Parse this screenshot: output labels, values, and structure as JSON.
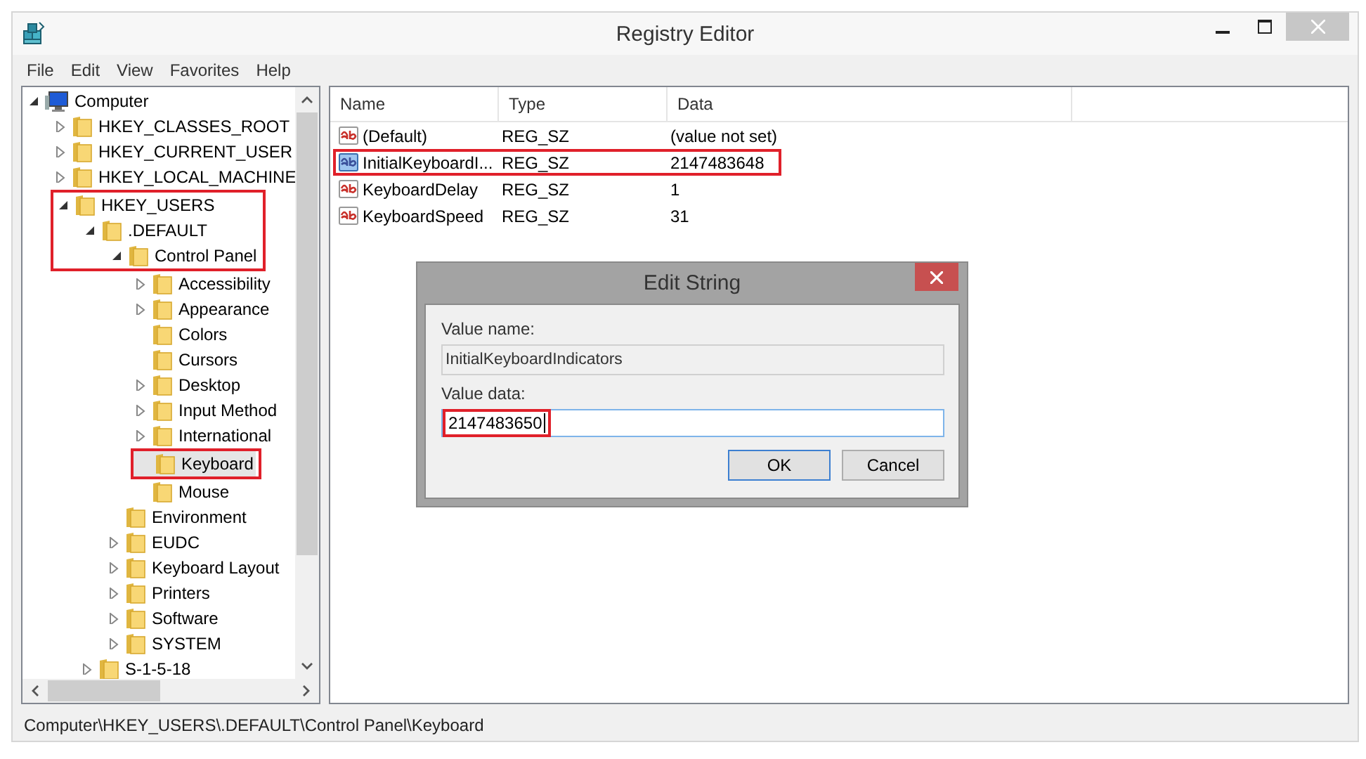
{
  "window": {
    "title": "Registry Editor"
  },
  "menu": [
    "File",
    "Edit",
    "View",
    "Favorites",
    "Help"
  ],
  "tree": [
    {
      "label": "Computer",
      "kind": "computer",
      "expanded": true,
      "selected": false,
      "highlighted": false,
      "children": [
        {
          "label": "HKEY_CLASSES_ROOT",
          "kind": "folder",
          "expanded": false,
          "selected": false,
          "highlighted": false
        },
        {
          "label": "HKEY_CURRENT_USER",
          "kind": "folder",
          "expanded": false,
          "selected": false,
          "highlighted": false
        },
        {
          "label": "HKEY_LOCAL_MACHINE",
          "kind": "folder",
          "expanded": false,
          "selected": false,
          "highlighted": false
        },
        {
          "label": "HKEY_USERS",
          "kind": "folder",
          "expanded": true,
          "selected": false,
          "highlighted": true,
          "children": [
            {
              "label": ".DEFAULT",
              "kind": "folder",
              "expanded": true,
              "selected": false,
              "highlighted": true,
              "children": [
                {
                  "label": "Control Panel",
                  "kind": "folder",
                  "expanded": true,
                  "selected": false,
                  "highlighted": true,
                  "children": [
                    {
                      "label": "Accessibility",
                      "kind": "folder",
                      "expanded": false,
                      "selected": false,
                      "highlighted": false
                    },
                    {
                      "label": "Appearance",
                      "kind": "folder",
                      "expanded": false,
                      "selected": false,
                      "highlighted": false
                    },
                    {
                      "label": "Colors",
                      "kind": "folder",
                      "selected": false,
                      "highlighted": false
                    },
                    {
                      "label": "Cursors",
                      "kind": "folder",
                      "selected": false,
                      "highlighted": false
                    },
                    {
                      "label": "Desktop",
                      "kind": "folder",
                      "expanded": false,
                      "selected": false,
                      "highlighted": false
                    },
                    {
                      "label": "Input Method",
                      "kind": "folder",
                      "expanded": false,
                      "selected": false,
                      "highlighted": false
                    },
                    {
                      "label": "International",
                      "kind": "folder",
                      "expanded": false,
                      "selected": false,
                      "highlighted": false
                    },
                    {
                      "label": "Keyboard",
                      "kind": "folder",
                      "selected": true,
                      "highlighted": true
                    },
                    {
                      "label": "Mouse",
                      "kind": "folder",
                      "selected": false,
                      "highlighted": false
                    }
                  ]
                },
                {
                  "label": "Environment",
                  "kind": "folder",
                  "selected": false,
                  "highlighted": false
                },
                {
                  "label": "EUDC",
                  "kind": "folder",
                  "expanded": false,
                  "selected": false,
                  "highlighted": false
                },
                {
                  "label": "Keyboard Layout",
                  "kind": "folder",
                  "expanded": false,
                  "selected": false,
                  "highlighted": false
                },
                {
                  "label": "Printers",
                  "kind": "folder",
                  "expanded": false,
                  "selected": false,
                  "highlighted": false
                },
                {
                  "label": "Software",
                  "kind": "folder",
                  "expanded": false,
                  "selected": false,
                  "highlighted": false
                },
                {
                  "label": "SYSTEM",
                  "kind": "folder",
                  "expanded": false,
                  "selected": false,
                  "highlighted": false
                }
              ]
            },
            {
              "label": "S-1-5-18",
              "kind": "folder",
              "expanded": false,
              "selected": false,
              "highlighted": false
            }
          ]
        }
      ]
    }
  ],
  "values": {
    "columns": [
      "Name",
      "Type",
      "Data"
    ],
    "rows": [
      {
        "name": "(Default)",
        "type": "REG_SZ",
        "data": "(value not set)",
        "selected": false,
        "highlighted": false
      },
      {
        "name": "InitialKeyboardI...",
        "type": "REG_SZ",
        "data": "2147483648",
        "selected": true,
        "highlighted": true
      },
      {
        "name": "KeyboardDelay",
        "type": "REG_SZ",
        "data": "1",
        "selected": false,
        "highlighted": false
      },
      {
        "name": "KeyboardSpeed",
        "type": "REG_SZ",
        "data": "31",
        "selected": false,
        "highlighted": false
      }
    ]
  },
  "dialog": {
    "title": "Edit String",
    "value_name_label": "Value name:",
    "value_name": "InitialKeyboardIndicators",
    "value_data_label": "Value data:",
    "value_data": "2147483650",
    "value_data_highlighted": true,
    "buttons": [
      {
        "label": "OK",
        "default": true
      },
      {
        "label": "Cancel",
        "default": false
      }
    ]
  },
  "status_bar": "Computer\\HKEY_USERS\\.DEFAULT\\Control Panel\\Keyboard"
}
